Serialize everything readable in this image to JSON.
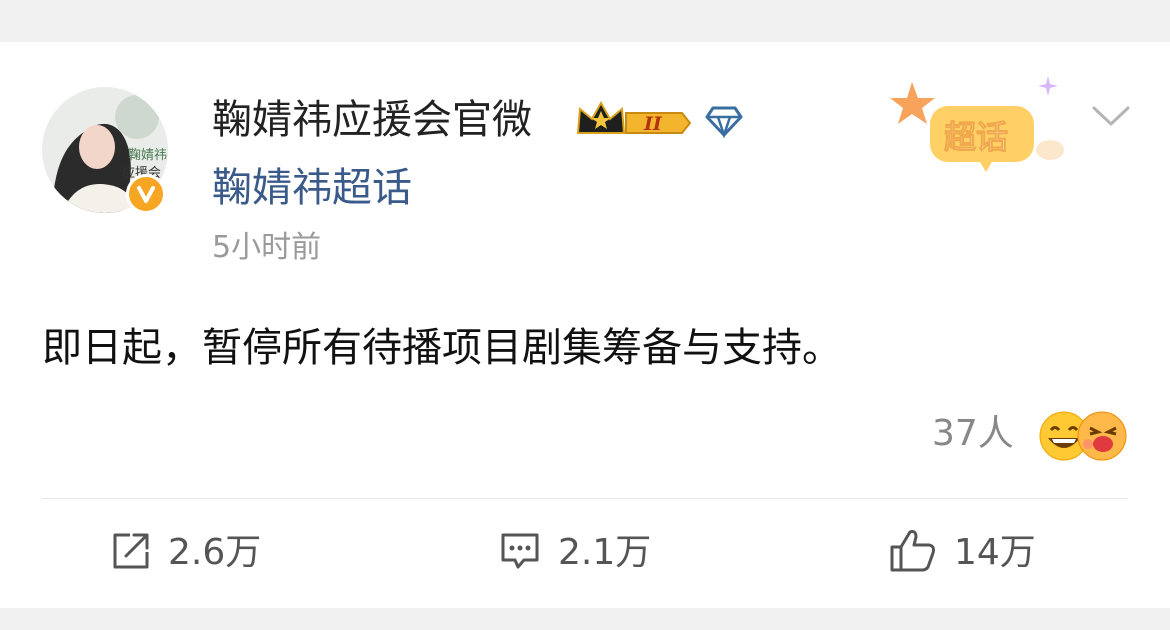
{
  "post": {
    "username": "鞠婧祎应援会官微",
    "level_badge": "II",
    "supertopic_link": "鞠婧祎超话",
    "time": "5小时前",
    "supertopic_badge": "超话",
    "avatar_caption": "鞠婧祎\n应援会",
    "content": "即日起，暂停所有待播项目剧集筹备与支持。",
    "reactions_count": "37人"
  },
  "actions": {
    "repost": "2.6万",
    "comment": "2.1万",
    "like": "14万"
  },
  "colors": {
    "topic_link": "#3a5a8a",
    "verified_badge": "#f6a623",
    "time_text": "#9a9a9a"
  },
  "icons": {
    "repost": "repost-icon",
    "comment": "comment-icon",
    "like": "thumbs-up-icon",
    "verified": "verified-icon",
    "crown": "crown-icon",
    "diamond": "diamond-icon",
    "dropdown": "chevron-down-icon"
  }
}
